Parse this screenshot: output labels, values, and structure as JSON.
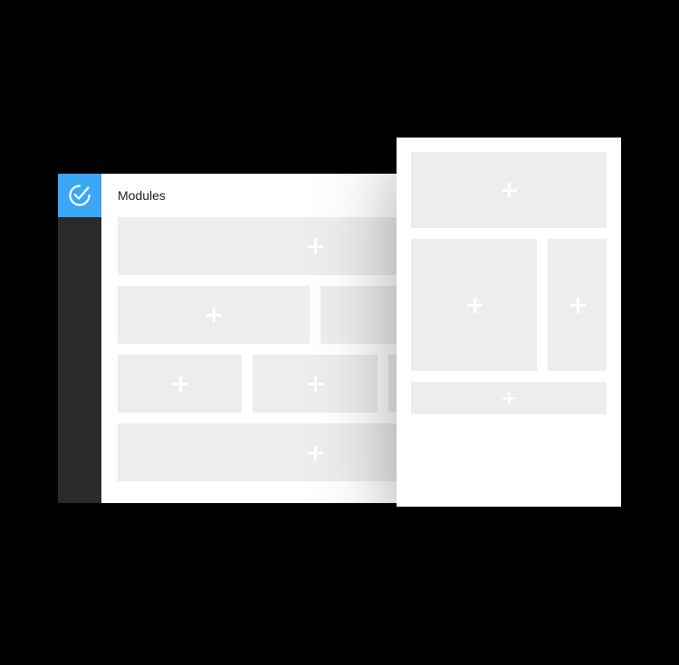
{
  "header": {
    "title": "Modules"
  },
  "logo": {
    "name": "app-logo"
  }
}
